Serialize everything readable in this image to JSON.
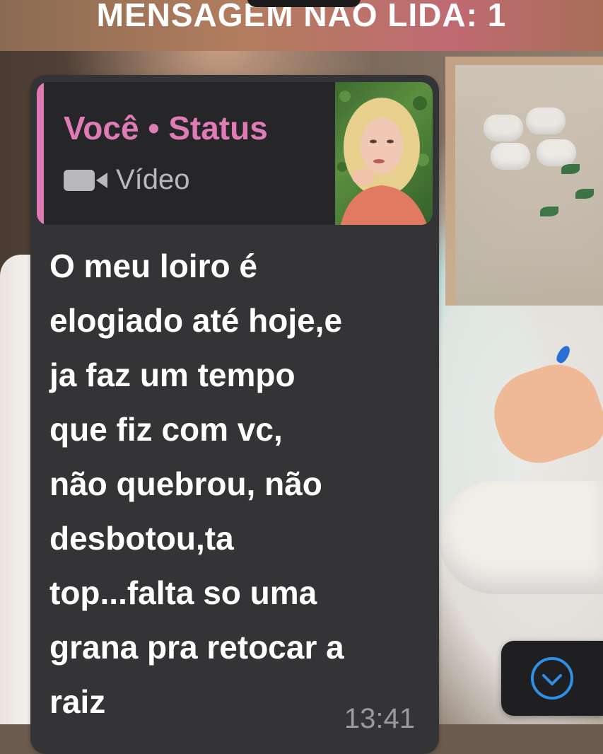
{
  "banner": {
    "unread_text": "MENSAGEM NÃO LIDA: 1"
  },
  "reply": {
    "title": "Você • Status",
    "type_icon": "video-camera-icon",
    "type_label": "Vídeo",
    "accent_color": "#e07ab5"
  },
  "message": {
    "text": "O meu loiro é\nelogiado até hoje,e\nja faz um tempo\nque fiz com vc,\nnão quebrou, não\ndesbotou,ta\ntop...falta so uma\ngrana pra retocar a\nraiz",
    "time": "13:41"
  },
  "scroll_button": {
    "icon": "chevron-down-circle-icon",
    "accent_color": "#2e8fe6"
  }
}
